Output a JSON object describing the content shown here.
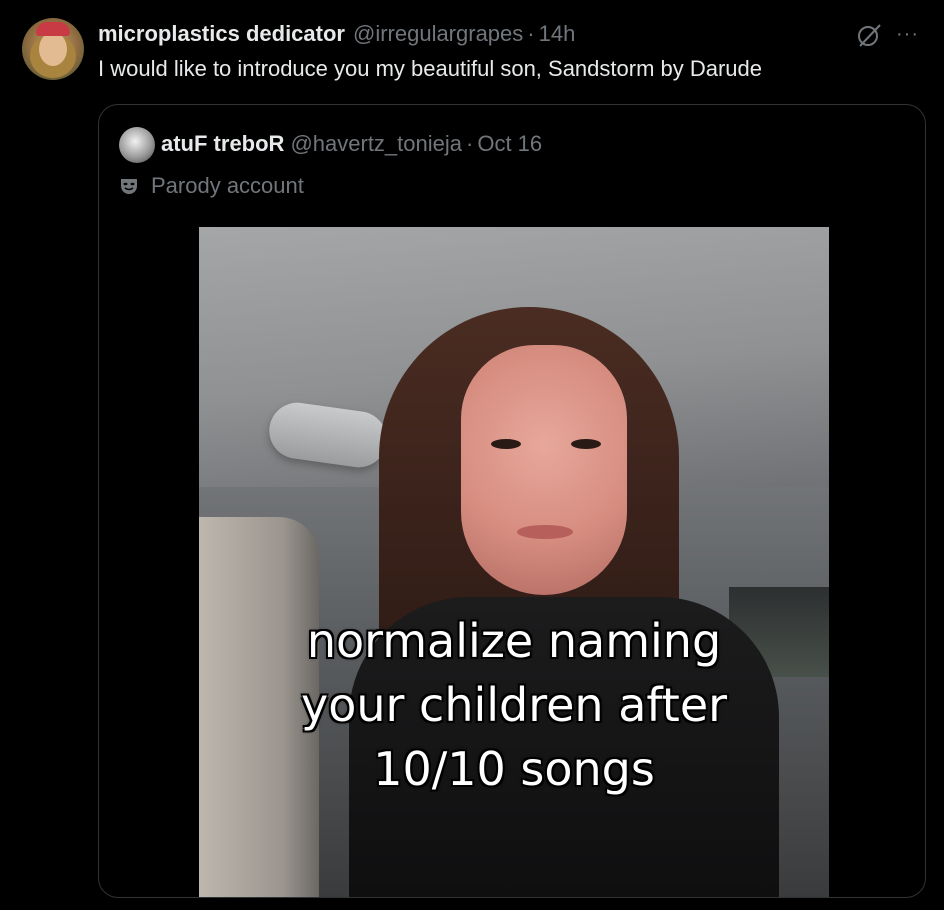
{
  "tweet": {
    "display_name": "microplastics dedicator",
    "handle": "@irregulargrapes",
    "separator": "·",
    "time": "14h",
    "text": "I would like to introduce you my beautiful son, Sandstorm by Darude",
    "more_label": "···"
  },
  "quoted": {
    "display_name": "atuF treboR",
    "handle": "@havertz_tonieja",
    "separator": "·",
    "time": "Oct 16",
    "label": "Parody account",
    "caption_lines": [
      "normalize naming",
      "your children after",
      "10/10 songs"
    ]
  },
  "icons": {
    "grok": "grok-icon",
    "more": "more-icon",
    "parody": "mask-icon"
  },
  "colors": {
    "background": "#000000",
    "primary_text": "#e7e9ea",
    "secondary_text": "#71767b",
    "border": "#2f3336"
  }
}
